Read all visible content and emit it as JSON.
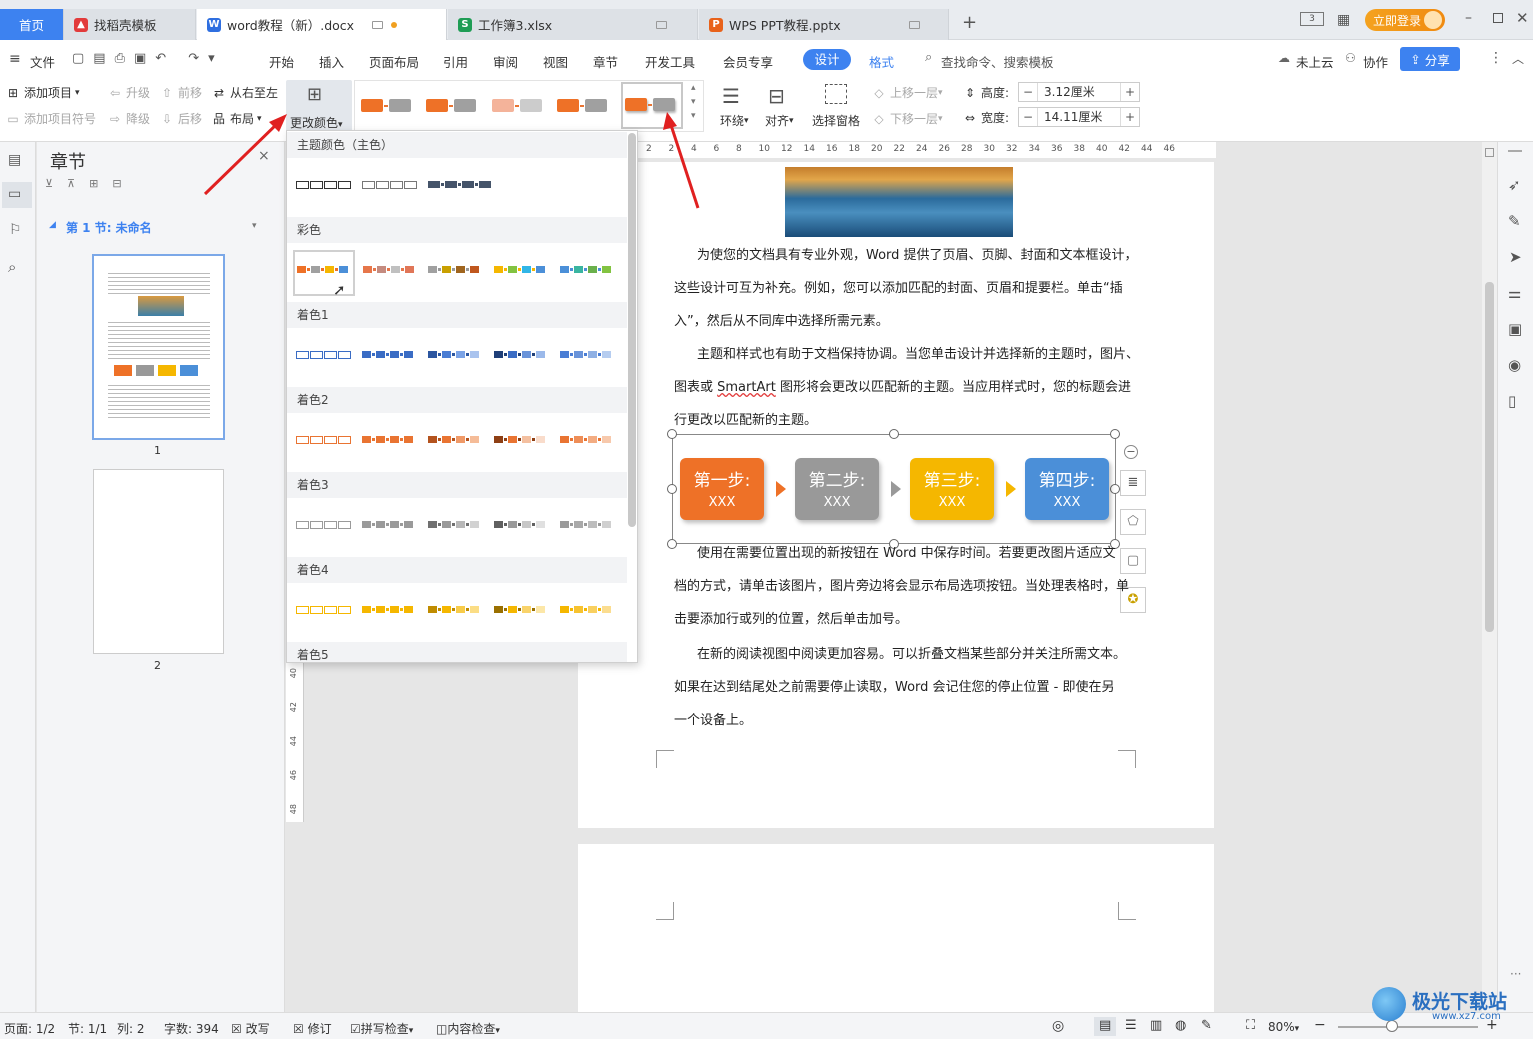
{
  "tabs": {
    "home": "首页",
    "t1": "找稻壳模板",
    "t2": "word教程（新）.docx",
    "t3": "工作簿3.xlsx",
    "t4": "WPS PPT教程.pptx",
    "login": "立即登录"
  },
  "menu": {
    "file": "文件",
    "items": [
      "开始",
      "插入",
      "页面布局",
      "引用",
      "审阅",
      "视图",
      "章节",
      "开发工具",
      "会员专享"
    ],
    "design": "设计",
    "format": "格式",
    "search": "查找命令、搜索模板",
    "cloud": "未上云",
    "collab": "协作",
    "share": "分享"
  },
  "ribbon": {
    "add_item": "添加项目",
    "add_bullet": "添加项目符号",
    "upgrade": "升级",
    "downgrade": "降级",
    "forward": "前移",
    "backward": "后移",
    "rtl": "从右至左",
    "layout": "布局",
    "change_color": "更改颜色",
    "wrap": "环绕",
    "align": "对齐",
    "select_pane": "选择窗格",
    "bring_forward": "上移一层",
    "send_backward": "下移一层",
    "height_label": "高度:",
    "height_value": "3.12厘米",
    "width_label": "宽度:",
    "width_value": "14.11厘米"
  },
  "chapter": {
    "title": "章节",
    "section": "第 1 节: 未命名",
    "page1": "1",
    "page2": "2"
  },
  "dropdown": {
    "groups": [
      "主题颜色（主色）",
      "彩色",
      "着色1",
      "着色2",
      "着色3",
      "着色4",
      "着色5"
    ]
  },
  "ruler": [
    "2",
    "2",
    "4",
    "6",
    "8",
    "10",
    "12",
    "14",
    "16",
    "18",
    "20",
    "22",
    "24",
    "26",
    "28",
    "30",
    "32",
    "34",
    "36",
    "38",
    "40",
    "42",
    "44",
    "46"
  ],
  "vruler": [
    "40",
    "42",
    "44",
    "46",
    "48"
  ],
  "doc": {
    "p1_l1": "为使您的文档具有专业外观，Word  提供了页眉、页脚、封面和文本框设计，",
    "p1_l2": "这些设计可互为补充。例如，您可以添加匹配的封面、页眉和提要栏。单击“插",
    "p1_l3": "入”，然后从不同库中选择所需元素。",
    "p2_l1": "主题和样式也有助于文档保持协调。当您单击设计并选择新的主题时，图片、",
    "p2_l2a": "图表或  ",
    "p2_l2b": "SmartArt",
    "p2_l2c": "  图形将会更改以匹配新的主题。当应用样式时，您的标题会进",
    "p2_l3": "行更改以匹配新的主题。",
    "p3_l1": "使用在需要位置出现的新按钮在  Word  中保存时间。若要更改图片适应文",
    "p3_l2": "档的方式，请单击该图片，图片旁边将会显示布局选项按钮。当处理表格时，单",
    "p3_l3": "击要添加行或列的位置，然后单击加号。",
    "p4_l1": "在新的阅读视图中阅读更加容易。可以折叠文档某些部分并关注所需文本。",
    "p4_l2": "如果在达到结尾处之前需要停止读取，Word  会记住您的停止位置  -  即使在另",
    "p4_l3": "一个设备上。",
    "steps": [
      {
        "title": "第一步:",
        "sub": "XXX",
        "color": "#ee7127"
      },
      {
        "title": "第二步:",
        "sub": "XXX",
        "color": "#999999"
      },
      {
        "title": "第三步:",
        "sub": "XXX",
        "color": "#f5b700"
      },
      {
        "title": "第四步:",
        "sub": "XXX",
        "color": "#4b8fd8"
      }
    ]
  },
  "status": {
    "page": "页面: 1/2",
    "section": "节: 1/1",
    "col": "列: 2",
    "words": "字数: 394",
    "overwrite": "改写",
    "track": "修订",
    "spell": "拼写检查",
    "content": "内容检查",
    "zoom": "80%"
  },
  "watermark": "极光下载站",
  "watermark_url": "www.xz7.com"
}
